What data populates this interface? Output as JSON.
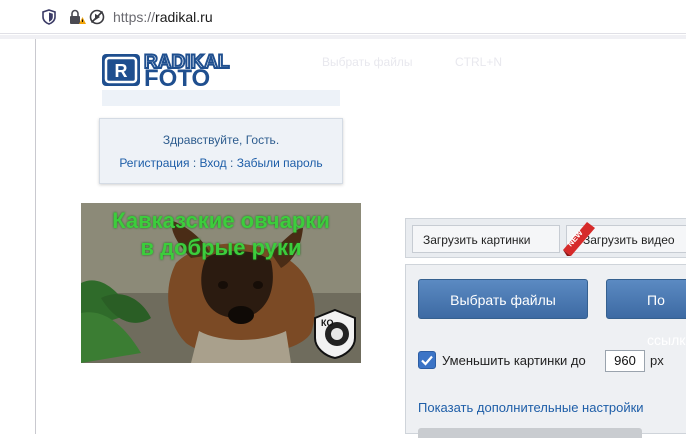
{
  "browser": {
    "url_scheme": "https://",
    "url_host": "radikal.ru",
    "icons": [
      "shield-icon",
      "lock-warning-icon",
      "autoplay-blocked-icon"
    ]
  },
  "site": {
    "logo_text_top": "RADIKAL",
    "logo_text_bottom": "FOTO",
    "logo_badge": "R",
    "ghost_menu": [
      "Выбрать файлы",
      "CTRL+N"
    ]
  },
  "login": {
    "greeting": "Здравствуйте, Гость.",
    "register": "Регистрация",
    "login": "Вход",
    "forgot": "Забыли пароль",
    "separator": ":"
  },
  "banner": {
    "line1": "Кавказские овчарки",
    "line2": "в добрые руки",
    "seal_text": "КО",
    "colors": {
      "text": "#3ccd3c"
    }
  },
  "upload": {
    "tabs": [
      {
        "label": "Загрузить картинки"
      },
      {
        "label": "Загрузить видео"
      }
    ],
    "new_badge": "NEW",
    "choose_files": "Выбрать файлы",
    "second_button": "По ссылке",
    "resize_checked": true,
    "resize_label": "Уменьшить картинки до",
    "resize_value": "960",
    "resize_unit": "px",
    "more_settings": "Показать дополнительные настройки"
  },
  "colors": {
    "accent": "#3d6aa3",
    "link": "#1e5ea8",
    "logo_blue": "#1f4f8f"
  }
}
